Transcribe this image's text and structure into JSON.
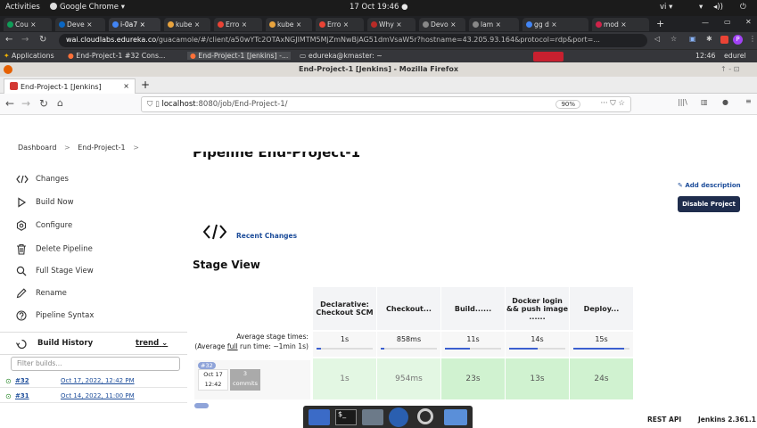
{
  "system_bar": {
    "activities": "Activities",
    "app": "Google Chrome ▾",
    "clock": "17 Oct  19:46 ●",
    "lang": "vi ▾"
  },
  "chrome": {
    "tabs": [
      {
        "label": "Cou ×",
        "color": "#0f9d58"
      },
      {
        "label": "Deve ×",
        "color": "#0a66c2"
      },
      {
        "label": "i-0a7 ×",
        "color": "#4285f4"
      },
      {
        "label": "kube ×",
        "color": "#e8a33d"
      },
      {
        "label": "Erro ×",
        "color": "#ea4335"
      },
      {
        "label": "kube ×",
        "color": "#e8a33d"
      },
      {
        "label": "Erro ×",
        "color": "#ea4335"
      },
      {
        "label": "Why ×",
        "color": "#b92b27"
      },
      {
        "label": "Devo ×",
        "color": "#888888"
      },
      {
        "label": "lam ×",
        "color": "#888888"
      },
      {
        "label": "gg d ×",
        "color": "#4285f4"
      },
      {
        "label": "mod ×",
        "color": "#d0234a"
      }
    ],
    "url_host": "wai.cloudlabs.edureka.co",
    "url_path": "/guacamole/#/client/a50wYTc2OTAxNGJlMTM5MjZmNwBjAG51dmVsaW5r?hostname=43.205.93.164&protocol=rdp&port=...",
    "bookmarks": [
      "Applications",
      "End-Project-1 #32 Cons...",
      "End-Project-1 [Jenkins] -...",
      "edureka@kmaster: ~"
    ],
    "remote_clock": "12:46",
    "remote_user": "edurel"
  },
  "firefox": {
    "window_title": "End-Project-1 [Jenkins] - Mozilla Firefox",
    "tab_label": "End-Project-1 [Jenkins]",
    "url_host": "localhost",
    "url_rest": ":8080/job/End-Project-1/",
    "zoom": "90%"
  },
  "jenkins": {
    "breadcrumb": [
      "Dashboard",
      "End-Project-1"
    ],
    "page_title": "Pipeline End-Project-1",
    "sidebar": [
      {
        "label": "Changes",
        "icon": "code-icon"
      },
      {
        "label": "Build Now",
        "icon": "play-icon"
      },
      {
        "label": "Configure",
        "icon": "gear-icon"
      },
      {
        "label": "Delete Pipeline",
        "icon": "trash-icon"
      },
      {
        "label": "Full Stage View",
        "icon": "search-icon"
      },
      {
        "label": "Rename",
        "icon": "pencil-icon"
      },
      {
        "label": "Pipeline Syntax",
        "icon": "help-icon"
      }
    ],
    "build_history": {
      "title": "Build History",
      "trend": "trend",
      "filter_placeholder": "Filter builds...",
      "builds": [
        {
          "id": "#32",
          "date": "Oct 17, 2022, 12:42 PM"
        },
        {
          "id": "#31",
          "date": "Oct 14, 2022, 11:00 PM"
        }
      ]
    },
    "add_description": "Add description",
    "disable_project": "Disable Project",
    "recent_changes": "Recent Changes",
    "stage_view_title": "Stage View",
    "stages": [
      {
        "name": "Declarative: Checkout SCM",
        "avg": "1s",
        "avg_fill": 0.08,
        "last": "1s"
      },
      {
        "name": "Checkout...",
        "avg": "858ms",
        "avg_fill": 0.06,
        "last": "954ms"
      },
      {
        "name": "Build......",
        "avg": "11s",
        "avg_fill": 0.45,
        "last": "23s"
      },
      {
        "name": "Docker login && push image ......",
        "avg": "14s",
        "avg_fill": 0.5,
        "last": "13s"
      },
      {
        "name": "Deploy...",
        "avg": "15s",
        "avg_fill": 0.9,
        "last": "24s"
      }
    ],
    "avg_label_1": "Average stage times:",
    "avg_label_2a": "(Average ",
    "avg_label_2b": "full",
    "avg_label_2c": " run time: ~1min 1s)",
    "last_build": {
      "badge": "#32",
      "date": "Oct 17",
      "time": "12:42",
      "commits_count": "3",
      "commits_label": "commits"
    },
    "footer": {
      "rest_api": "REST API",
      "version": "Jenkins 2.361.1"
    }
  },
  "colors": {
    "accent": "#1d4d9a",
    "success": "#2e8b2e",
    "button": "#1f2d4d"
  }
}
